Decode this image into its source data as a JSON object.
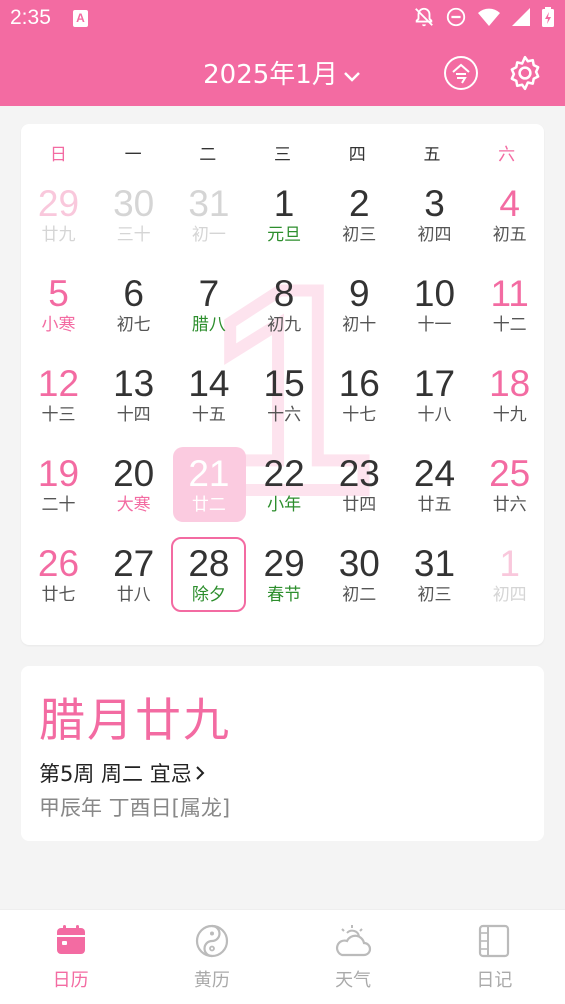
{
  "status_bar": {
    "time": "2:35",
    "badge": "A",
    "icons": [
      "bell-off-icon",
      "do-not-disturb-icon",
      "wifi-icon",
      "signal-icon",
      "battery-charging-icon"
    ]
  },
  "header": {
    "month_title": "2025年1月",
    "today_icon": "today-icon",
    "settings_icon": "gear-icon",
    "accent_color": "#f36ba2"
  },
  "calendar": {
    "watermark_month": "1",
    "weekdays": [
      "日",
      "一",
      "二",
      "三",
      "四",
      "五",
      "六"
    ],
    "weeks": [
      [
        {
          "day": "29",
          "sub": "廿九",
          "other": true,
          "weekend": true
        },
        {
          "day": "30",
          "sub": "三十",
          "other": true
        },
        {
          "day": "31",
          "sub": "初一",
          "other": true
        },
        {
          "day": "1",
          "sub": "元旦",
          "subtype": "holiday"
        },
        {
          "day": "2",
          "sub": "初三"
        },
        {
          "day": "3",
          "sub": "初四"
        },
        {
          "day": "4",
          "sub": "初五",
          "weekend": true
        }
      ],
      [
        {
          "day": "5",
          "sub": "小寒",
          "weekend": true,
          "subtype": "solar"
        },
        {
          "day": "6",
          "sub": "初七"
        },
        {
          "day": "7",
          "sub": "腊八",
          "subtype": "holiday"
        },
        {
          "day": "8",
          "sub": "初九"
        },
        {
          "day": "9",
          "sub": "初十"
        },
        {
          "day": "10",
          "sub": "十一"
        },
        {
          "day": "11",
          "sub": "十二",
          "weekend": true
        }
      ],
      [
        {
          "day": "12",
          "sub": "十三",
          "weekend": true
        },
        {
          "day": "13",
          "sub": "十四"
        },
        {
          "day": "14",
          "sub": "十五"
        },
        {
          "day": "15",
          "sub": "十六"
        },
        {
          "day": "16",
          "sub": "十七"
        },
        {
          "day": "17",
          "sub": "十八"
        },
        {
          "day": "18",
          "sub": "十九",
          "weekend": true
        }
      ],
      [
        {
          "day": "19",
          "sub": "二十",
          "weekend": true
        },
        {
          "day": "20",
          "sub": "大寒",
          "subtype": "solar"
        },
        {
          "day": "21",
          "sub": "廿二",
          "today": true
        },
        {
          "day": "22",
          "sub": "小年",
          "subtype": "holiday"
        },
        {
          "day": "23",
          "sub": "廿四"
        },
        {
          "day": "24",
          "sub": "廿五"
        },
        {
          "day": "25",
          "sub": "廿六",
          "weekend": true
        }
      ],
      [
        {
          "day": "26",
          "sub": "廿七",
          "weekend": true
        },
        {
          "day": "27",
          "sub": "廿八"
        },
        {
          "day": "28",
          "sub": "除夕",
          "selected": true,
          "subtype": "holiday"
        },
        {
          "day": "29",
          "sub": "春节",
          "subtype": "holiday"
        },
        {
          "day": "30",
          "sub": "初二"
        },
        {
          "day": "31",
          "sub": "初三"
        },
        {
          "day": "1",
          "sub": "初四",
          "other": true,
          "weekend": true
        }
      ]
    ]
  },
  "info": {
    "lunar_date": "腊月廿九",
    "week_line": "第5周 周二 宜忌",
    "ganzhi": "甲辰年 丁酉日[属龙]"
  },
  "nav": [
    {
      "label": "日历",
      "icon": "calendar-icon",
      "active": true
    },
    {
      "label": "黄历",
      "icon": "yin-yang-icon",
      "active": false
    },
    {
      "label": "天气",
      "icon": "weather-icon",
      "active": false
    },
    {
      "label": "日记",
      "icon": "diary-icon",
      "active": false
    }
  ]
}
